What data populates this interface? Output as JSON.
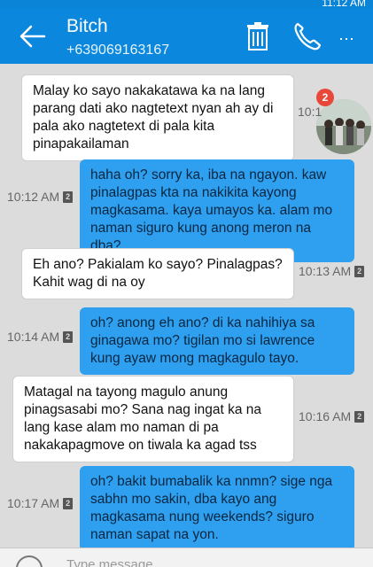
{
  "status": {
    "time": "11:12 AM"
  },
  "header": {
    "name": "Bitch",
    "number": "+639069163167"
  },
  "avatar_badge": "2",
  "avatar_stamp": "10:1",
  "messages": [
    {
      "dir": "in",
      "text": "Malay ko sayo nakakatawa ka na lang parang dati ako nagtetext nyan ah ay di pala ako nagtetext di pala kita pinapakailaman",
      "time": ""
    },
    {
      "dir": "out",
      "text": "haha oh? sorry ka, iba na ngayon. kaw pinalagpas kta na nakikita kayong magkasama. kaya umayos ka. alam mo naman siguro kung anong meron na dba?",
      "time": "10:12 AM"
    },
    {
      "dir": "in",
      "text": "Eh ano? Pakialam ko sayo? Pinalagpas? Kahit wag di na oy",
      "time": "10:13 AM"
    },
    {
      "dir": "out",
      "text": "oh? anong eh ano? di ka nahihiya sa ginagawa mo? tigilan mo si lawrence kung ayaw mong magkagulo tayo.",
      "time": "10:14 AM"
    },
    {
      "dir": "in",
      "text": "Matagal na tayong magulo anung pinagsasabi mo? Sana nag ingat ka na lang kase alam mo naman di pa nakakapagmove on tiwala ka agad tss",
      "time": "10:16 AM"
    },
    {
      "dir": "out",
      "text": "oh? bakit bumabalik ka nnmn? sige nga sabhn mo sakin, dba kayo ang magkasama nung weekends? siguro naman sapat na yon.",
      "time": "10:17 AM"
    }
  ],
  "sim_label": "2",
  "composer": {
    "placeholder": "Type message"
  }
}
